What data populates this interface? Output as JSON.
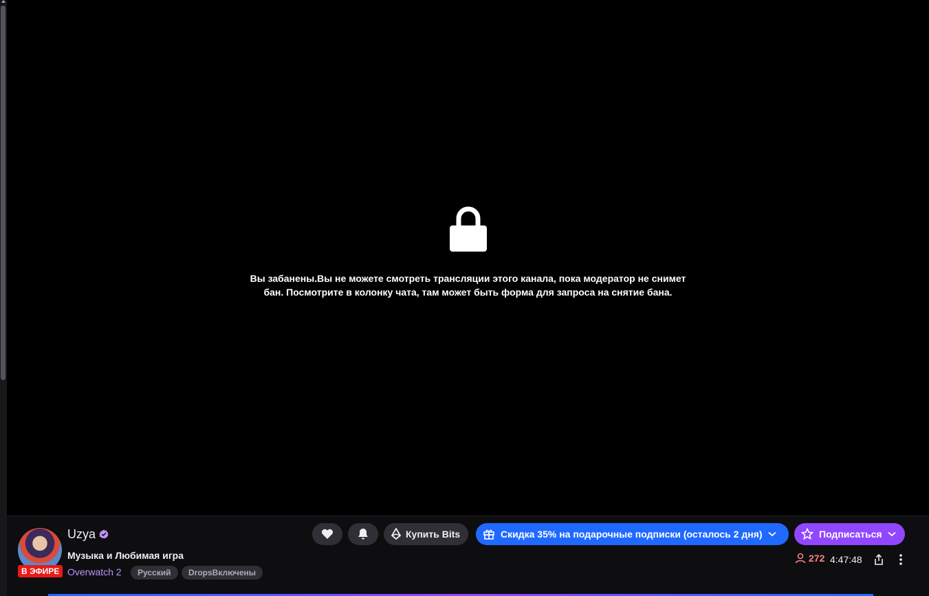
{
  "player": {
    "ban_message_line1": "Вы забанены.Вы не можете смотреть трансляции этого канала, пока модератор не снимет",
    "ban_message_line2": "бан. Посмотрите в колонку чата, там может быть форма для запроса на снятие бана.",
    "icon": "lock-icon"
  },
  "channel": {
    "name": "Uzya",
    "verified_icon": "verified-badge-icon",
    "live_label": "В ЭФИРЕ",
    "stream_title": "Музыка и Любимая игра",
    "game": "Overwatch 2",
    "tags": [
      "Русский",
      "DropsВключены"
    ]
  },
  "actions": {
    "follow_icon": "heart-icon",
    "notify_icon": "bell-icon",
    "bits_label": "Купить Bits",
    "gift_label": "Скидка 35% на подарочные подписки (осталось 2 дня)",
    "subscribe_label": "Подписаться"
  },
  "stats": {
    "viewers": "272",
    "uptime": "4:47:48"
  },
  "colors": {
    "accent_purple": "#9147ff",
    "gift_blue": "#1f69ff",
    "live_red": "#e91916",
    "viewer_red": "#ff8280",
    "game_purple": "#bf94ff"
  }
}
